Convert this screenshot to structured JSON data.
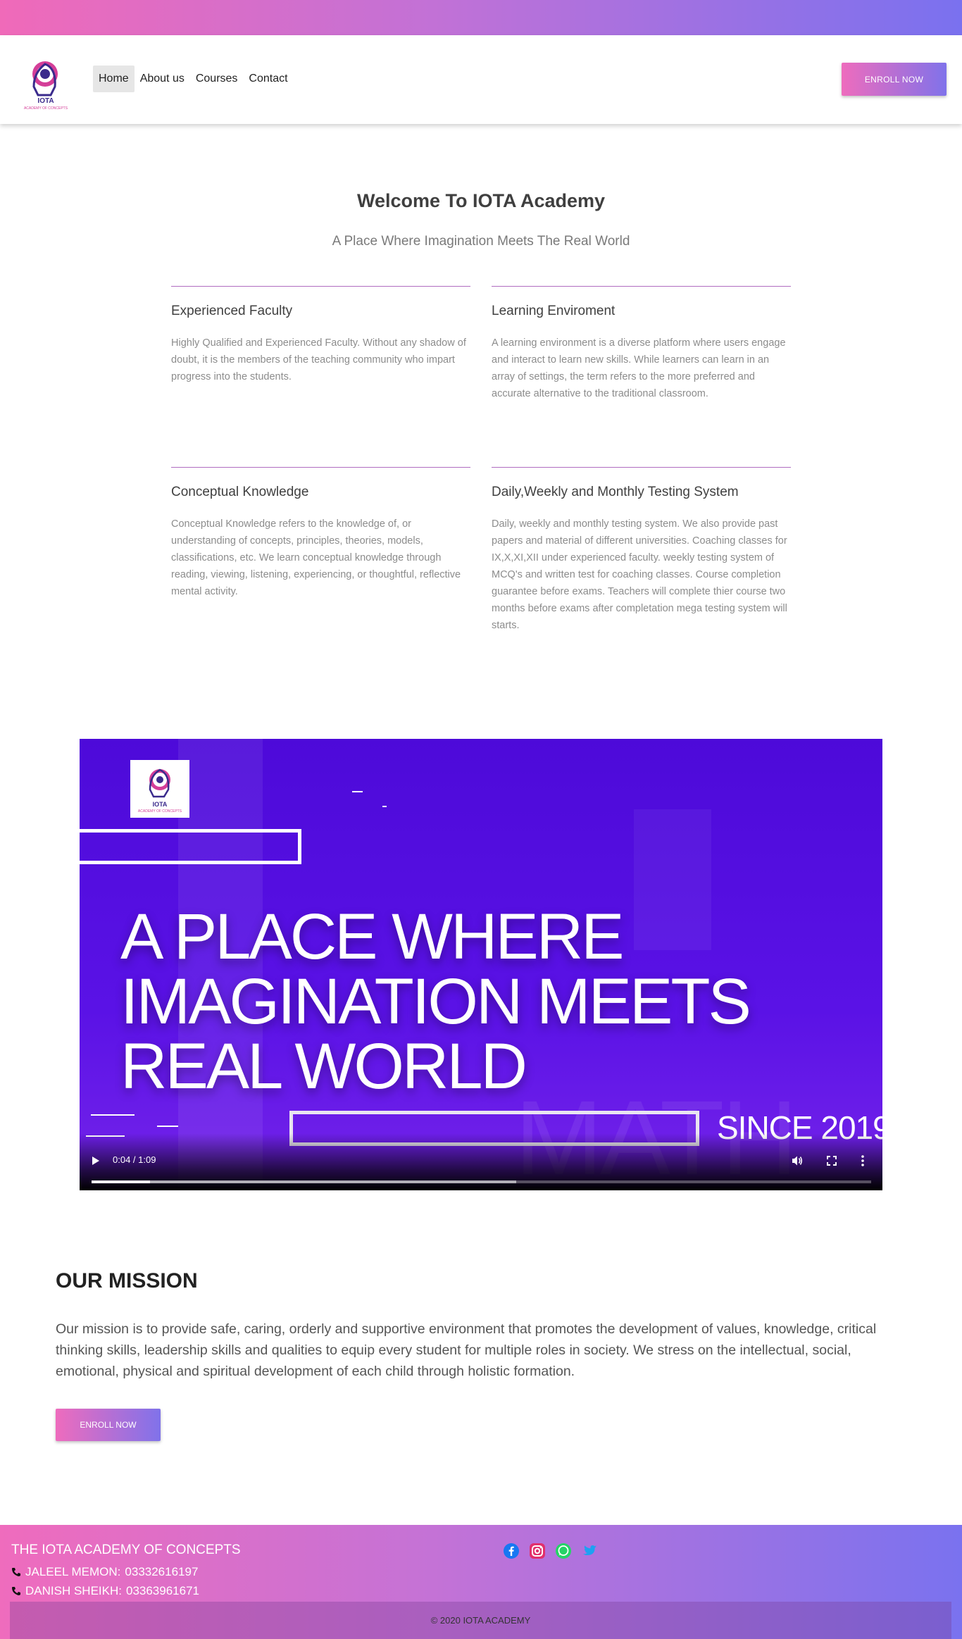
{
  "brand": {
    "logo_text": "IOTA",
    "logo_subtext": "ACADEMY OF CONCEPTS"
  },
  "nav": {
    "links": [
      {
        "label": "Home",
        "active": true
      },
      {
        "label": "About us",
        "active": false
      },
      {
        "label": "Courses",
        "active": false
      },
      {
        "label": "Contact",
        "active": false
      }
    ],
    "enroll_label": "ENROLL NOW"
  },
  "welcome": {
    "title": "Welcome To IOTA Academy",
    "subtitle": "A Place Where Imagination Meets The Real World"
  },
  "features": [
    {
      "title": "Experienced Faculty",
      "text": "Highly Qualified and Experienced Faculty. Without any shadow of doubt, it is the members of the teaching community who impart progress into the students."
    },
    {
      "title": "Learning Enviroment",
      "text": "A learning environment is a diverse platform where users engage and interact to learn new skills. While learners can learn in an array of settings, the term refers to the more preferred and accurate alternative to the traditional classroom."
    },
    {
      "title": "Conceptual Knowledge",
      "text": "Conceptual Knowledge refers to the knowledge of, or understanding of concepts, principles, theories, models, classifications, etc. We learn conceptual knowledge through reading, viewing, listening, experiencing, or thoughtful, reflective mental activity."
    },
    {
      "title": "Daily,Weekly and Monthly Testing System",
      "text": "Daily, weekly and monthly testing system. We also provide past papers and material of different universities. Coaching classes for IX,X,XI,XII under experienced faculty. weekly testing system of MCQ's and written test for coaching classes. Course completion guarantee before exams. Teachers will complete thier course two months before exams after completation mega testing system will starts."
    }
  ],
  "video": {
    "headline_lines": [
      "A PLACE WHERE",
      "IMAGINATION MEETS",
      "REAL WORLD"
    ],
    "since": "SINCE 2019",
    "watermark": "MATH",
    "time": "0:04 / 1:09",
    "progress": 0.075,
    "buffered": 0.545
  },
  "mission": {
    "title": "OUR MISSION",
    "text": "Our mission is to provide safe, caring, orderly and supportive environment that promotes the development of values, knowledge, critical thinking skills, leadership skills and qualities to equip every student for multiple roles in society. We stress on the intellectual, social, emotional, physical and spiritual development of each child through holistic formation.",
    "button": "ENROLL NOW"
  },
  "footer": {
    "title": "THE IOTA ACADEMY OF CONCEPTS",
    "contacts": [
      {
        "name": "JALEEL MEMON:",
        "phone": "03332616197"
      },
      {
        "name": "DANISH SHEIKH:",
        "phone": "03363961671"
      }
    ],
    "socials": [
      "facebook-icon",
      "instagram-icon",
      "whatsapp-icon",
      "twitter-icon"
    ],
    "copyright": "© 2020 IOTA ACADEMY"
  },
  "colors": {
    "gradient_start": "#ef6cbd",
    "gradient_end": "#7a72ef",
    "video_bg": "#5210e0"
  }
}
